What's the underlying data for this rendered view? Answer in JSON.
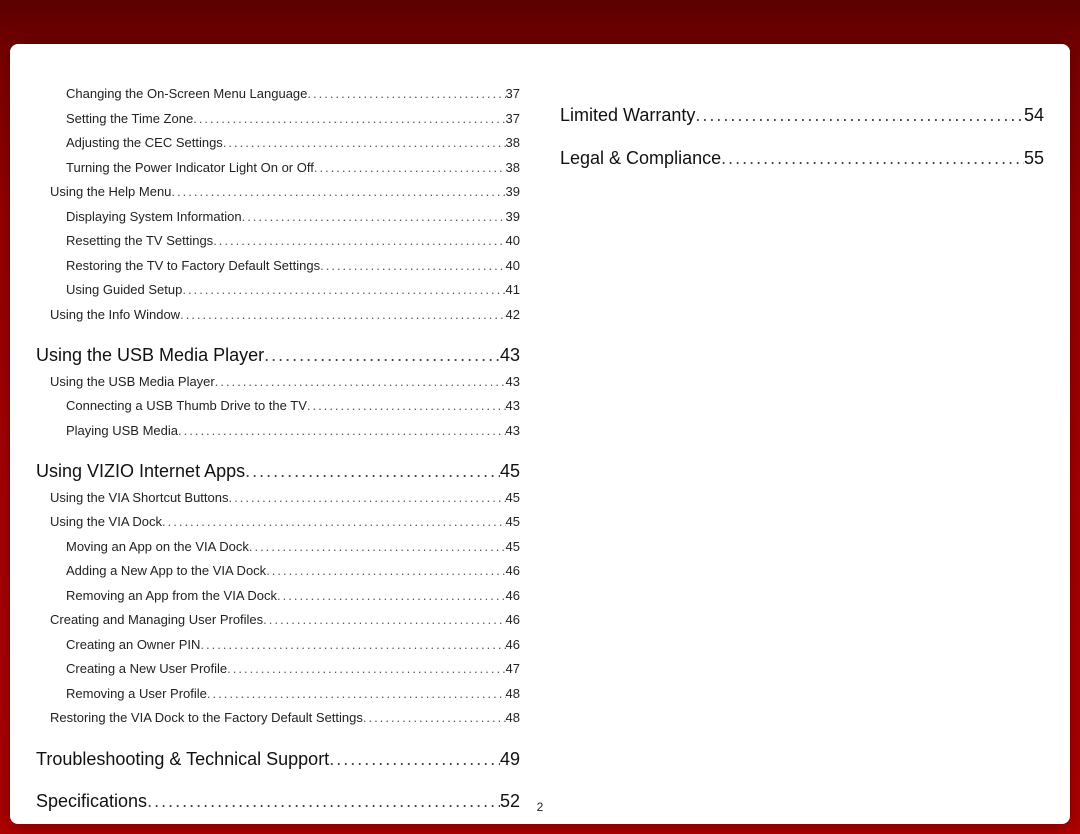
{
  "page_number": "2",
  "col1": [
    {
      "level": 3,
      "label": "Changing the On-Screen Menu Language",
      "page": "37"
    },
    {
      "level": 3,
      "label": "Setting the Time Zone",
      "page": "37"
    },
    {
      "level": 3,
      "label": "Adjusting the CEC Settings",
      "page": "38"
    },
    {
      "level": 3,
      "label": "Turning the Power Indicator Light On or Off",
      "page": "38"
    },
    {
      "level": 2,
      "label": "Using the Help Menu",
      "page": "39"
    },
    {
      "level": 3,
      "label": "Displaying System Information",
      "page": "39"
    },
    {
      "level": 3,
      "label": "Resetting the TV Settings",
      "page": "40"
    },
    {
      "level": 3,
      "label": "Restoring the TV to Factory Default Settings",
      "page": "40"
    },
    {
      "level": 3,
      "label": "Using Guided Setup",
      "page": "41"
    },
    {
      "level": 2,
      "label": "Using the Info Window",
      "page": "42"
    },
    {
      "level": 1,
      "label": "Using the USB Media Player",
      "page": "43"
    },
    {
      "level": 2,
      "label": "Using the USB Media Player",
      "page": "43"
    },
    {
      "level": 3,
      "label": "Connecting a USB Thumb Drive to the TV",
      "page": "43"
    },
    {
      "level": 3,
      "label": "Playing USB Media",
      "page": "43"
    },
    {
      "level": 1,
      "label": "Using VIZIO Internet Apps",
      "page": "45"
    },
    {
      "level": 2,
      "label": "Using the VIA Shortcut Buttons",
      "page": "45"
    },
    {
      "level": 2,
      "label": "Using the VIA Dock",
      "page": "45"
    },
    {
      "level": 3,
      "label": "Moving an App on the VIA Dock",
      "page": "45"
    },
    {
      "level": 3,
      "label": "Adding a New App to the VIA Dock",
      "page": "46"
    },
    {
      "level": 3,
      "label": "Removing an App from the VIA Dock",
      "page": "46"
    },
    {
      "level": 2,
      "label": "Creating and Managing User Profiles",
      "page": "46"
    },
    {
      "level": 3,
      "label": "Creating an Owner PIN",
      "page": "46"
    },
    {
      "level": 3,
      "label": "Creating a New User Profile",
      "page": "47"
    },
    {
      "level": 3,
      "label": "Removing a User Profile",
      "page": "48"
    },
    {
      "level": 2,
      "label": "Restoring the VIA Dock to the Factory Default Settings",
      "page": "48"
    },
    {
      "level": 1,
      "label": "Troubleshooting & Technical Support",
      "page": "49"
    },
    {
      "level": 1,
      "label": "Specifications",
      "page": "52"
    }
  ],
  "col2": [
    {
      "level": 1,
      "label": "Limited Warranty",
      "page": "54"
    },
    {
      "level": 1,
      "label": "Legal & Compliance",
      "page": "55"
    }
  ]
}
